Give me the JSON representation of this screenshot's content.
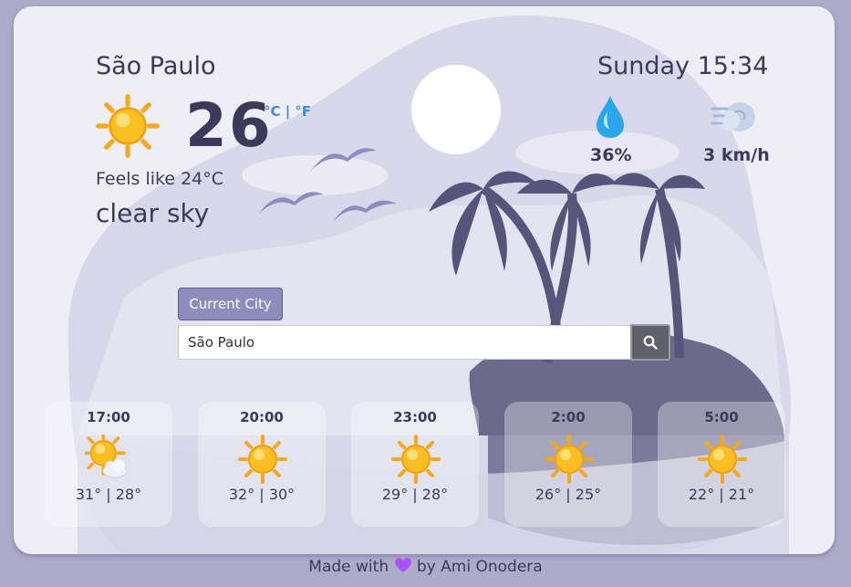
{
  "current": {
    "city": "São Paulo",
    "datetime": "Sunday 15:34",
    "temperature": "26",
    "units": "°C | °F",
    "feels_like": "Feels like 24°C",
    "description": "clear sky",
    "humidity": "36%",
    "wind": "3 km/h"
  },
  "search": {
    "current_city_label": "Current City",
    "value": "São Paulo"
  },
  "forecast": [
    {
      "time": "17:00",
      "range": "31° | 28°",
      "icon": "sun-behind-cloud-icon"
    },
    {
      "time": "20:00",
      "range": "32° | 30°",
      "icon": "sun-icon"
    },
    {
      "time": "23:00",
      "range": "29° | 28°",
      "icon": "sun-icon"
    },
    {
      "time": "2:00",
      "range": "26° | 25°",
      "icon": "sun-icon"
    },
    {
      "time": "5:00",
      "range": "22° | 21°",
      "icon": "sun-icon"
    }
  ],
  "footer": {
    "prefix": "Made with",
    "suffix": "by Ami Onodera"
  },
  "colors": {
    "accent_blue": "#3e8be0",
    "button": "#8e8bbd",
    "text": "#3c3a5a",
    "background": "#aeabca"
  }
}
